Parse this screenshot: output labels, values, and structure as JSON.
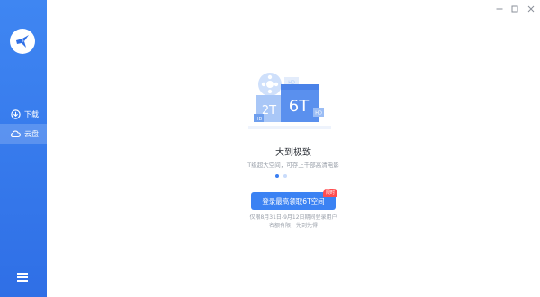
{
  "window": {
    "controls": {
      "minimize": "—",
      "maximize": "□",
      "close": "✕"
    }
  },
  "sidebar": {
    "logo_icon": "swallow-logo-icon",
    "items": [
      {
        "label": "下载",
        "icon": "download-icon"
      },
      {
        "label": "云盘",
        "icon": "cloud-icon",
        "active": true
      }
    ],
    "menu_icon": "hamburger-icon"
  },
  "illustration": {
    "labels": {
      "big": "6T",
      "small": "2T",
      "hd1": "HD",
      "hd2": "HD",
      "hd3": "HD"
    }
  },
  "promo": {
    "title": "大到极致",
    "subtitle": "T级超大空间，可存上千部高清电影",
    "carousel": {
      "count": 2,
      "active_index": 0
    },
    "button_label": "登录最高领取6T空间",
    "badge": "限时",
    "note_line1": "仅限8月31日-9月12日期间登录用户",
    "note_line2": "名额有限，先到先得"
  },
  "colors": {
    "primary": "#3b82f3",
    "sidebar": "#2f6fe6",
    "badge": "#ff4d4f"
  }
}
